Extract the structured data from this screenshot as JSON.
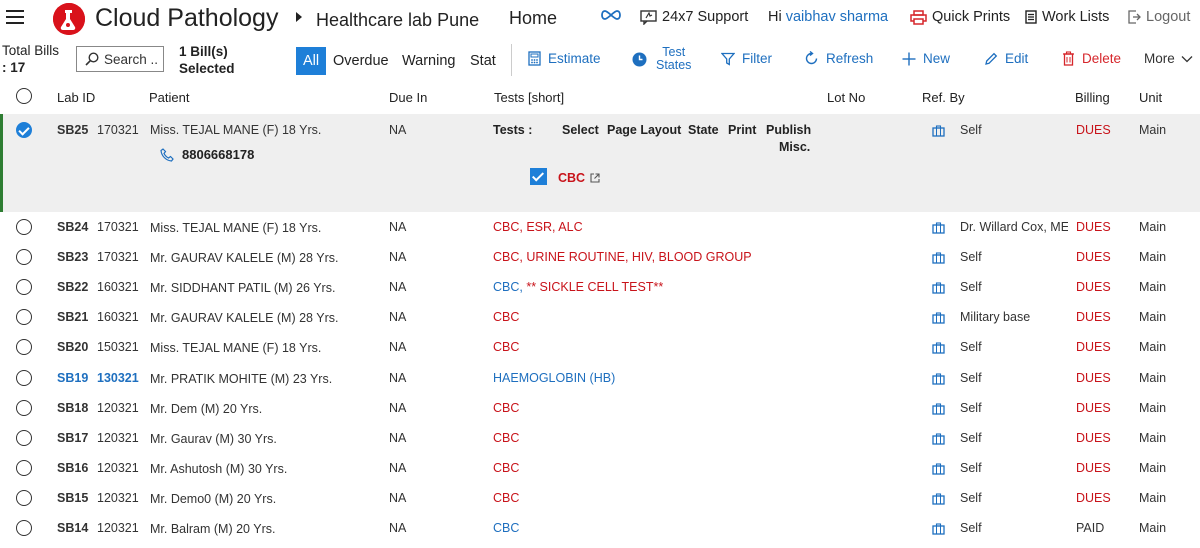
{
  "header": {
    "app_title": "Cloud Pathology",
    "lab_name": "Healthcare lab Pune",
    "home": "Home",
    "support": "24x7 Support",
    "greeting": "Hi",
    "user": "vaibhav sharma",
    "quick_prints": "Quick Prints",
    "work_lists": "Work Lists",
    "logout": "Logout",
    "brand_color": "#d9121b"
  },
  "toolbar": {
    "total_bills_label": "Total Bills",
    "total_bills_count": ": 17",
    "search_placeholder": "Search ...",
    "bills_selected_line1": "1 Bill(s)",
    "bills_selected_line2": "Selected",
    "filter_tabs": [
      "All",
      "Overdue",
      "Warning",
      "Stat"
    ],
    "estimate": "Estimate",
    "test_states_line1": "Test",
    "test_states_line2": "States",
    "filter": "Filter",
    "refresh": "Refresh",
    "new": "New",
    "edit": "Edit",
    "delete": "Delete",
    "more": "More",
    "accent_color": "#1e7fd8"
  },
  "table": {
    "columns": [
      "Lab ID",
      "Patient",
      "Due In",
      "Tests [short]",
      "Lot No",
      "Ref. By",
      "Billing",
      "Unit"
    ],
    "selected_detail": {
      "phone": "8806668178",
      "tests_label": "Tests :",
      "actions": [
        "Select",
        "Page Layout",
        "State",
        "Print",
        "Publish"
      ],
      "publish_sub": "Misc.",
      "test_item": "CBC"
    },
    "rows": [
      {
        "id": "SB25",
        "date": "170321",
        "patient": "Miss. TEJAL MANE (F) 18 Yrs.",
        "due": "NA",
        "tests": "",
        "ref": "Self",
        "billing": "DUES",
        "unit": "Main"
      },
      {
        "id": "SB24",
        "date": "170321",
        "patient": "Miss. TEJAL MANE (F) 18 Yrs.",
        "due": "NA",
        "tests": "CBC, ESR, ALC",
        "ref": "Dr. Willard Cox, ME",
        "billing": "DUES",
        "unit": "Main"
      },
      {
        "id": "SB23",
        "date": "170321",
        "patient": "Mr. GAURAV KALELE (M) 28 Yrs.",
        "due": "NA",
        "tests": "CBC, URINE ROUTINE, HIV, BLOOD GROUP",
        "ref": "Self",
        "billing": "DUES",
        "unit": "Main"
      },
      {
        "id": "SB22",
        "date": "160321",
        "patient": "Mr. SIDDHANT PATIL (M) 26 Yrs.",
        "due": "NA",
        "tests_blue": "CBC, ",
        "tests": "** SICKLE CELL TEST**",
        "ref": "Self",
        "billing": "DUES",
        "unit": "Main"
      },
      {
        "id": "SB21",
        "date": "160321",
        "patient": "Mr. GAURAV KALELE (M) 28 Yrs.",
        "due": "NA",
        "tests": "CBC",
        "ref": "Military base",
        "billing": "DUES",
        "unit": "Main"
      },
      {
        "id": "SB20",
        "date": "150321",
        "patient": "Miss. TEJAL MANE (F) 18 Yrs.",
        "due": "NA",
        "tests": "CBC",
        "ref": "Self",
        "billing": "DUES",
        "unit": "Main"
      },
      {
        "id": "SB19",
        "date": "130321",
        "patient": "Mr. PRATIK MOHITE (M) 23 Yrs.",
        "due": "NA",
        "tests": "HAEMOGLOBIN (HB)",
        "ref": "Self",
        "billing": "DUES",
        "unit": "Main"
      },
      {
        "id": "SB18",
        "date": "120321",
        "patient": "Mr. Dem (M) 20 Yrs.",
        "due": "NA",
        "tests": "CBC",
        "ref": "Self",
        "billing": "DUES",
        "unit": "Main"
      },
      {
        "id": "SB17",
        "date": "120321",
        "patient": "Mr. Gaurav (M) 30 Yrs.",
        "due": "NA",
        "tests": "CBC",
        "ref": "Self",
        "billing": "DUES",
        "unit": "Main"
      },
      {
        "id": "SB16",
        "date": "120321",
        "patient": "Mr. Ashutosh (M) 30 Yrs.",
        "due": "NA",
        "tests": "CBC",
        "ref": "Self",
        "billing": "DUES",
        "unit": "Main"
      },
      {
        "id": "SB15",
        "date": "120321",
        "patient": "Mr. Demo0 (M) 20 Yrs.",
        "due": "NA",
        "tests": "CBC",
        "ref": "Self",
        "billing": "DUES",
        "unit": "Main"
      },
      {
        "id": "SB14",
        "date": "120321",
        "patient": "Mr. Balram (M) 20 Yrs.",
        "due": "NA",
        "tests": "CBC",
        "ref": "Self",
        "billing": "PAID",
        "unit": "Main"
      }
    ]
  }
}
